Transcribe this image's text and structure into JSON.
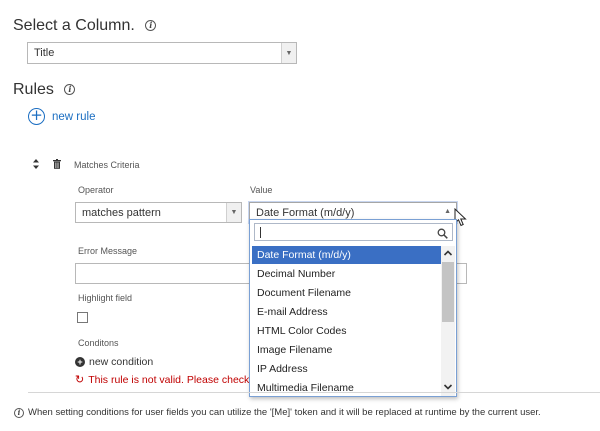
{
  "column_section": {
    "title": "Select a Column.",
    "selected_value": "Title"
  },
  "rules_section": {
    "title": "Rules",
    "new_rule_label": "new rule"
  },
  "rule": {
    "heading": "Matches Criteria",
    "operator_label": "Operator",
    "operator_value": "matches pattern",
    "value_label": "Value",
    "value_selected": "Date Format (m/d/y)",
    "error_message_label": "Error Message",
    "highlight_field_label": "Highlight field",
    "conditions_label": "Conditons",
    "new_condition_label": "new condition",
    "invalid_text": "This rule is not valid. Please check to"
  },
  "value_dropdown": {
    "search_value": "",
    "options": [
      "Date Format (m/d/y)",
      "Decimal Number",
      "Document Filename",
      "E-mail Address",
      "HTML Color Codes",
      "Image Filename",
      "IP Address",
      "Multimedia Filename"
    ],
    "selected_index": 0
  },
  "footer": {
    "note": "When setting conditions for user fields you can utilize the '[Me]' token and it will be replaced at runtime by the current user."
  },
  "colors": {
    "accent_blue": "#1b6ec2",
    "selection_blue": "#3a6fc4",
    "error_red": "#c00000"
  },
  "icons": [
    "info-icon",
    "add-circle-icon",
    "move-icon",
    "delete-icon",
    "chevron-down-icon",
    "chevron-up-icon",
    "search-icon",
    "plus-icon",
    "refresh-icon",
    "mouse-cursor-icon"
  ]
}
